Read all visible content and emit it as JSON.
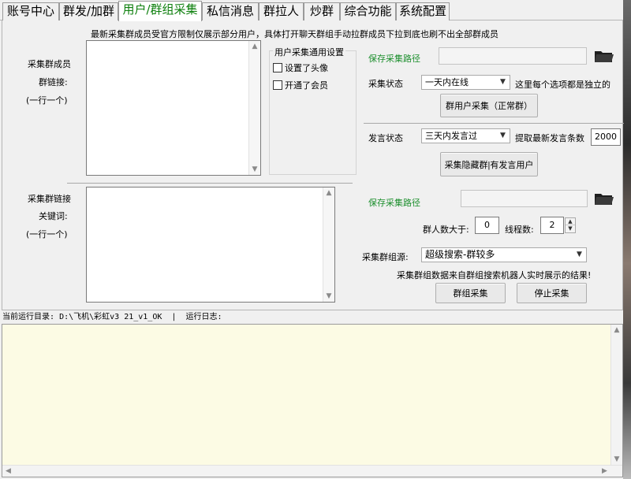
{
  "tabs": [
    {
      "label": "账号中心"
    },
    {
      "label": "群发/加群"
    },
    {
      "label": "用户/群组采集",
      "active": true
    },
    {
      "label": "私信消息"
    },
    {
      "label": "群拉人"
    },
    {
      "label": "炒群"
    },
    {
      "label": "综合功能"
    },
    {
      "label": "系统配置"
    }
  ],
  "member_section": {
    "notice": "最新采集群成员受官方限制仅展示部分用户，具体打开聊天群组手动拉群成员下拉到底也刷不出全部群成员",
    "label_line1": "采集群成员",
    "label_line2": "群链接:",
    "label_line3": "(一行一个)",
    "textarea_value": "",
    "settings_group": {
      "title": "用户采集通用设置",
      "checkbox_avatar": "设置了头像",
      "checkbox_member": "开通了会员"
    },
    "save_path_label": "保存采集路径",
    "save_path_value": "",
    "status_label": "采集状态",
    "status_select": "一天内在线",
    "status_note": "这里每个选项都是独立的",
    "collect_button": "群用户采集（正常群）",
    "speech_label": "发言状态",
    "speech_select": "三天内发言过",
    "fetch_label": "提取最新发言条数",
    "fetch_value": "2000",
    "hidden_button": "采集隐藏群|有发言用户"
  },
  "group_section": {
    "label_line1": "采集群链接",
    "label_line2": "关键词:",
    "label_line3": "(一行一个)",
    "textarea_value": "",
    "save_path_label": "保存采集路径",
    "save_path_value": "",
    "members_gt_label": "群人数大于:",
    "members_gt_value": "0",
    "threads_label": "线程数:",
    "threads_value": "2",
    "source_label": "采集群组源:",
    "source_select": "超级搜索-群较多",
    "source_note": "采集群组数据来自群组搜索机器人实时展示的结果!",
    "collect_button": "群组采集",
    "stop_button": "停止采集"
  },
  "status_line": {
    "dir_label": "当前运行目录:",
    "dir_value": "D:\\飞机\\彩虹v3 21_v1_OK",
    "separator": "|",
    "log_label": "运行日志:"
  },
  "log_text": "",
  "colors": {
    "active_tab_text": "#0c7f0c",
    "green_label": "#1d8f2e",
    "log_background": "#fcfbe4"
  }
}
